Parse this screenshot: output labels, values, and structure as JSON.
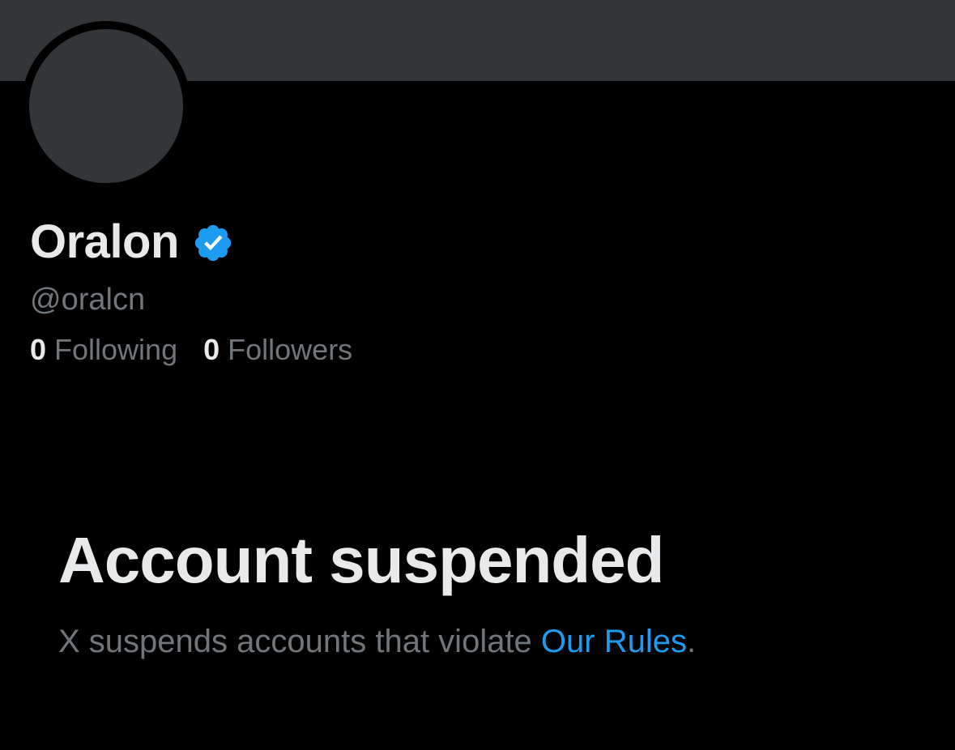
{
  "profile": {
    "display_name": "Oralon",
    "handle": "@oralcn",
    "verified_icon": "verified-badge-icon",
    "following_count": "0",
    "following_label": "Following",
    "followers_count": "0",
    "followers_label": "Followers"
  },
  "notice": {
    "title": "Account suspended",
    "body_prefix": "X suspends accounts that violate ",
    "rules_link": "Our Rules",
    "body_suffix": "."
  },
  "colors": {
    "background": "#000000",
    "banner": "#333639",
    "primary_text": "#e7e9ea",
    "secondary_text": "#71767b",
    "accent": "#1d9bf0"
  }
}
